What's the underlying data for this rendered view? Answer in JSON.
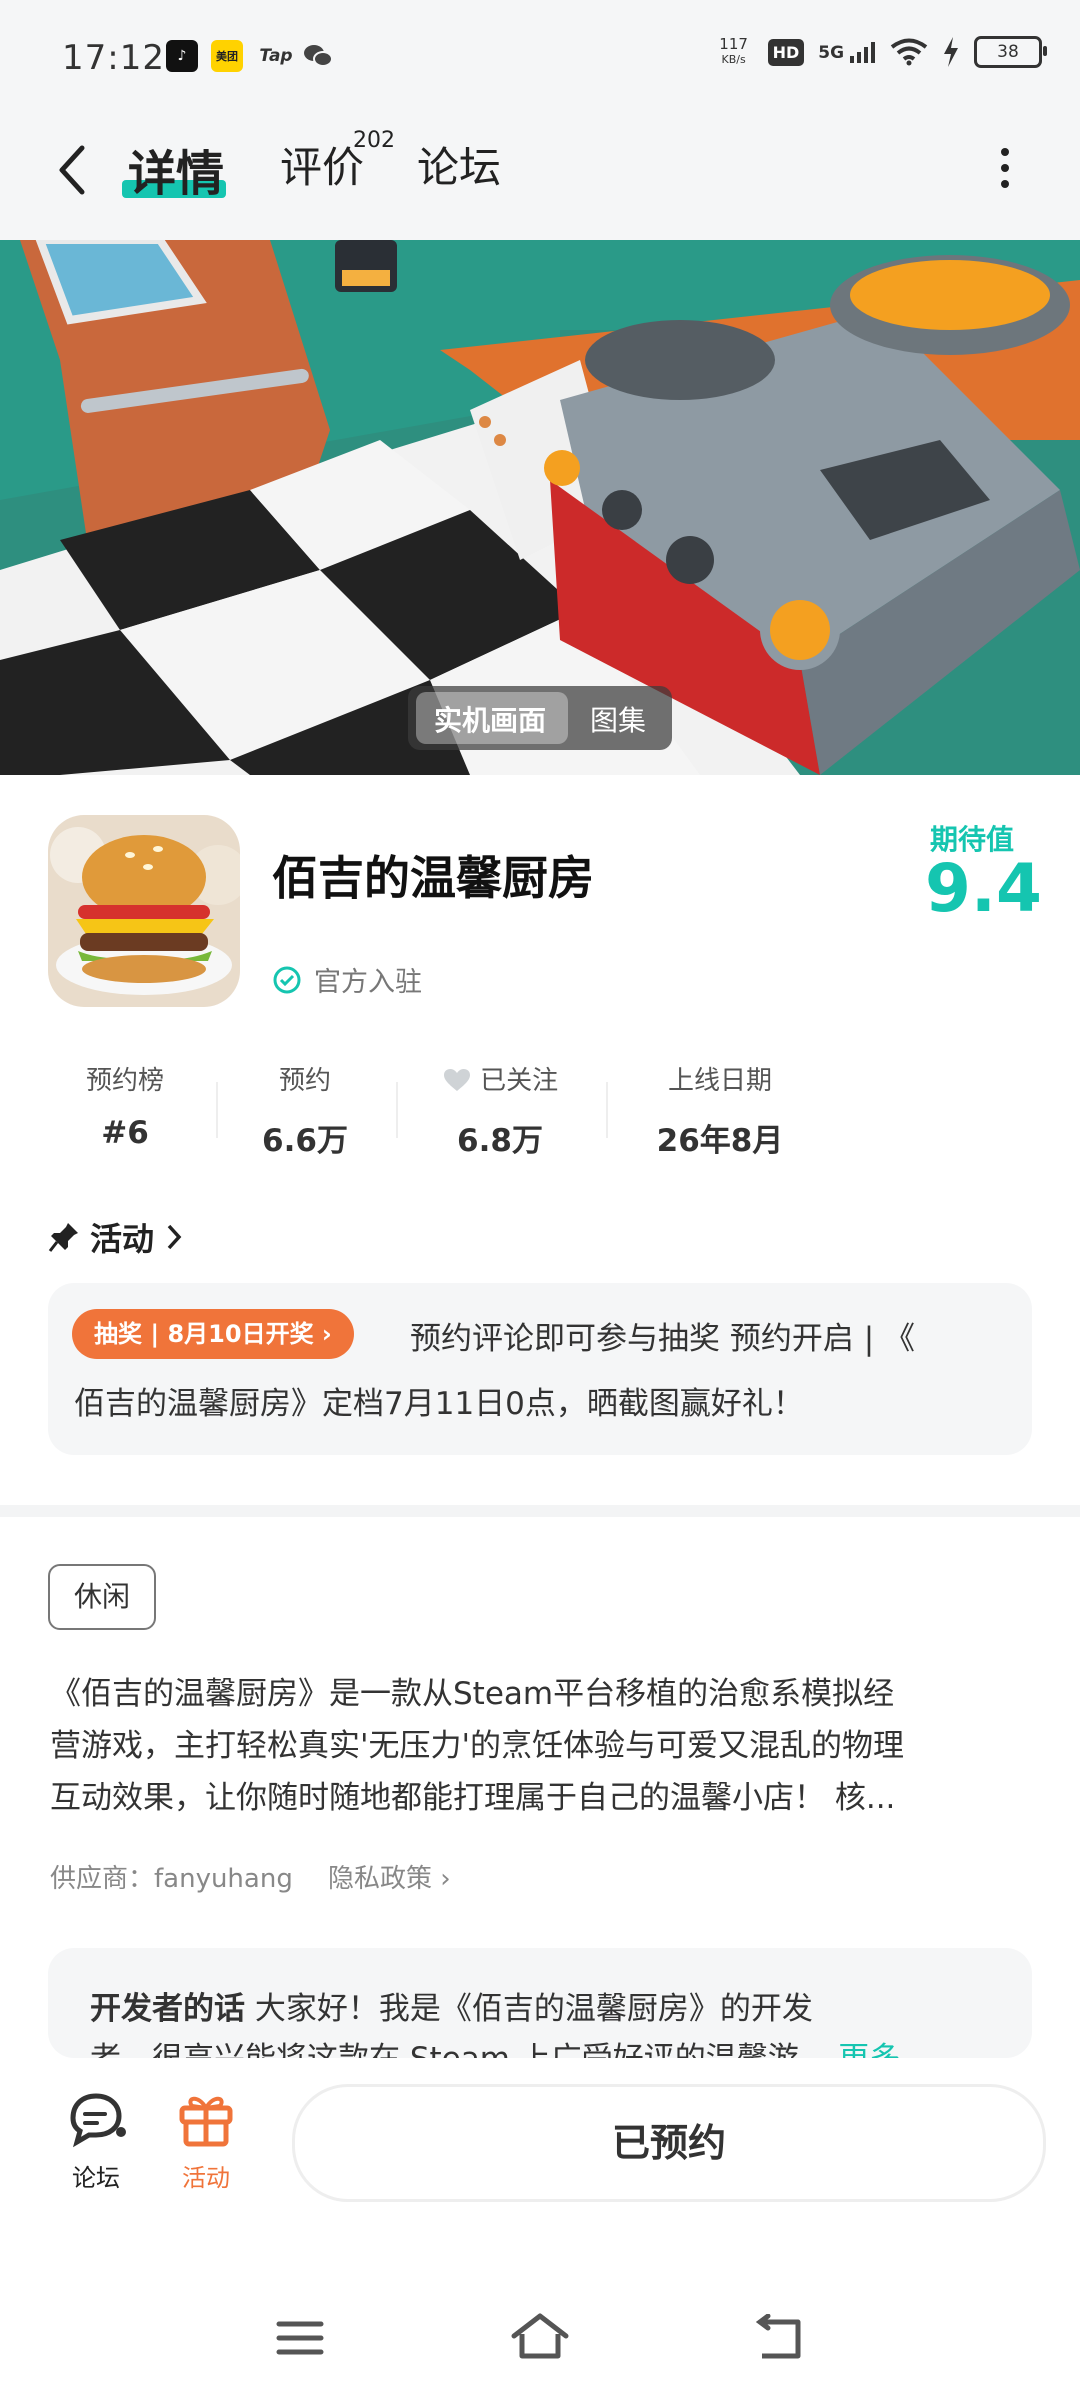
{
  "status": {
    "time": "17:12",
    "apps": [
      {
        "name": "tiktok-icon",
        "label": "♪"
      },
      {
        "name": "meituan-icon",
        "label": "美团"
      },
      {
        "name": "tap-icon",
        "label": "Tap"
      },
      {
        "name": "wechat-icon",
        "label": ""
      }
    ],
    "net_speed_value": "117",
    "net_speed_unit": "KB/s",
    "hd": "HD",
    "network": "5G",
    "battery": "38"
  },
  "header": {
    "tabs": [
      {
        "label": "详情",
        "active": true
      },
      {
        "label": "评价",
        "count": "202"
      },
      {
        "label": "论坛"
      }
    ]
  },
  "hero": {
    "toggle_options": [
      "实机画面",
      "图集"
    ],
    "selected": "实机画面"
  },
  "game": {
    "title": "佰吉的温馨厨房",
    "official_label": "官方入驻",
    "expect_label": "期待值",
    "expect_value": "9.4"
  },
  "stats": [
    {
      "label": "预约榜",
      "value": "#6"
    },
    {
      "label": "预约",
      "value": "6.6万"
    },
    {
      "label": "已关注",
      "value": "6.8万"
    },
    {
      "label": "上线日期",
      "value": "26年8月"
    }
  ],
  "activity": {
    "title": "活动",
    "badge": "抽奖 | 8月10日开奖 ›",
    "text_line1": "预约评论即可参与抽奖 预约开启 | 《",
    "text_line2": "佰吉的温馨厨房》定档7月11日0点，晒截图赢好礼！"
  },
  "description": {
    "tag": "休闲",
    "text_lines": [
      "《佰吉的温馨厨房》是一款从Steam平台移植的治愈系模拟经",
      "营游戏，主打轻松真实'无压力'的烹饪体验与可爱又混乱的物理",
      "互动效果，让你随时随地都能打理属于自己的温馨小店！ 核..."
    ],
    "supplier": "供应商：fanyuhang",
    "privacy": "隐私政策 ›"
  },
  "developer": {
    "heading": "开发者的话",
    "text": "大家好！我是《佰吉的温馨厨房》的开发",
    "text2": "者，很高兴能将这款在 Steam 上广受好评的温馨游...",
    "more": "更多"
  },
  "bottom": {
    "forum_label": "论坛",
    "activity_label": "活动",
    "reserve_button": "已预约"
  },
  "colors": {
    "accent": "#15c5b0",
    "orange": "#f0743a",
    "card_bg": "#f5f6f7"
  }
}
